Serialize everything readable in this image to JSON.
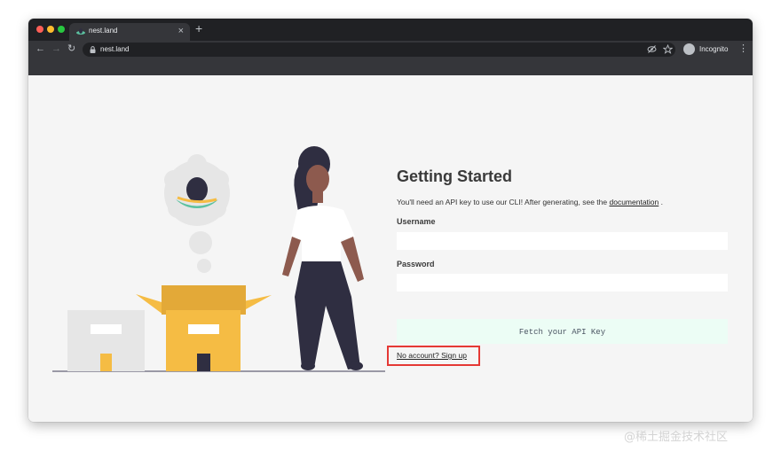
{
  "browser": {
    "tab_title": "nest.land",
    "tab_close": "×",
    "new_tab": "+",
    "url": "nest.land",
    "profile_label": "Incognito",
    "nav_back": "←",
    "nav_forward": "→",
    "nav_reload": "↻",
    "menu": "⋮"
  },
  "page": {
    "heading": "Getting Started",
    "intro_text": "You'll need an API key to use our CLI! After generating, see the ",
    "doc_link": "documentation",
    "intro_suffix": " .",
    "username_label": "Username",
    "username_value": "",
    "password_label": "Password",
    "password_value": "",
    "fetch_button": "Fetch your API Key",
    "signup_link": "No account? Sign up"
  },
  "watermark": "@稀土掘金技术社区",
  "colors": {
    "tabbar": "#202124",
    "toolbar": "#35363a",
    "page_bg": "#f5f5f5",
    "button_bg": "#ecfdf5",
    "highlight": "#e53935",
    "box_yellow": "#f5bc44",
    "skin": "#8d5a4e",
    "hair": "#2f2e41"
  }
}
